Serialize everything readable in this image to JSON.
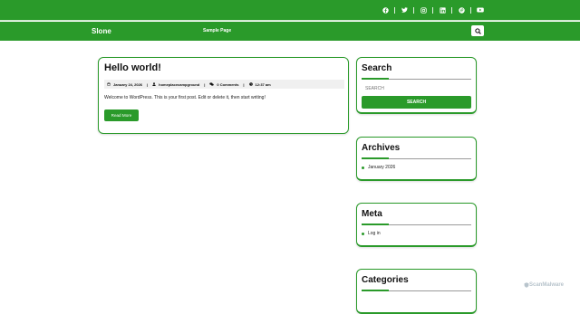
{
  "header": {
    "social_icons": [
      "facebook-icon",
      "twitter-icon",
      "instagram-icon",
      "linkedin-icon",
      "pinterest-icon",
      "youtube-icon"
    ],
    "site_title": "Slone",
    "nav_items": [
      "Sample Page"
    ]
  },
  "post": {
    "title": "Hello world!",
    "date": "January 24, 2026",
    "author": "homeplacecampground",
    "comments": "0 Comments",
    "time": "12:37 am",
    "excerpt": "Welcome to WordPress. This is your first post. Edit or delete it, then start writing!",
    "read_more": "Read More"
  },
  "sidebar": {
    "search": {
      "title": "Search",
      "placeholder": "SEARCH",
      "button": "SEARCH"
    },
    "archives": {
      "title": "Archives",
      "items": [
        "January 2026"
      ]
    },
    "meta": {
      "title": "Meta",
      "items": [
        "Log in"
      ]
    },
    "categories": {
      "title": "Categories"
    }
  },
  "watermark": "ScanMalware",
  "colors": {
    "brand": "#2a9a2a"
  }
}
